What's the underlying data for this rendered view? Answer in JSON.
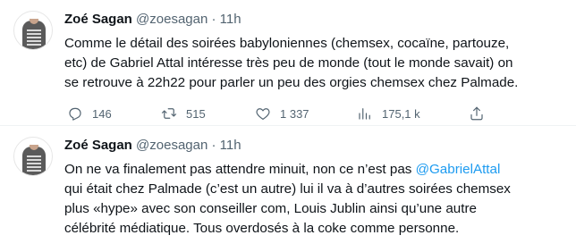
{
  "tweets": [
    {
      "author_name": "Zoé Sagan",
      "handle": "@zoesagan",
      "separator": "·",
      "time": "11h",
      "lines": [
        "Comme le détail des soirées babyloniennes (chemsex, cocaïne, partouze,",
        "etc) de Gabriel Attal intéresse très peu de monde (tout le monde savait) on",
        "se retrouve à 22h22 pour parler un peu des orgies chemsex chez Palmade."
      ],
      "stats": {
        "replies": "146",
        "retweets": "515",
        "likes": "1 337",
        "views": "175,1 k"
      },
      "icons": [
        "reply-icon",
        "retweet-icon",
        "like-icon",
        "views-icon",
        "share-icon"
      ]
    },
    {
      "author_name": "Zoé Sagan",
      "handle": "@zoesagan",
      "separator": "·",
      "time": "11h",
      "line1_prefix": "On ne va finalement pas attendre minuit, non ce n’est pas ",
      "mention": "@GabrielAttal",
      "lines_rest": [
        "qui était chez Palmade (c’est un autre) lui il va à d’autres soirées chemsex",
        "plus «hype» avec son conseiller com, Louis Jublin ainsi qu’une autre",
        "célébrité médiatique. Tous overdosés à la coke comme personne."
      ]
    }
  ],
  "colors": {
    "text": "#0f1419",
    "secondary": "#536471",
    "link": "#1d9bf0",
    "divider": "#eff3f4"
  }
}
